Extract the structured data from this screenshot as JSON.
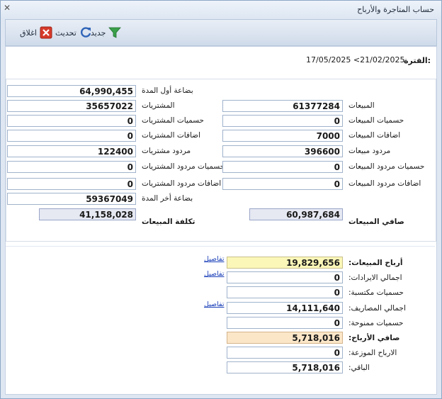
{
  "window": {
    "title": "حساب المتاجرة والأرباح"
  },
  "toolbar": {
    "new_label": "جديد",
    "refresh_label": "تحديث",
    "close_label": "اغلاق"
  },
  "period": {
    "label": "الفترة:",
    "value": "17/05/2025 <21/02/2025"
  },
  "left": {
    "opening_stock": {
      "label": "بضاعة أول المدة",
      "value": "64,990,455"
    },
    "purchases": {
      "label": "المشتريات",
      "value": "35657022"
    },
    "purchase_discounts": {
      "label": "حسميات المشتريات",
      "value": "0"
    },
    "purchase_additions": {
      "label": "اضافات المشتريات",
      "value": "0"
    },
    "purchase_returns": {
      "label": "مردود مشتريات",
      "value": "122400"
    },
    "purchase_return_discounts": {
      "label": "حسميات مردود المشتريات",
      "value": "0"
    },
    "purchase_return_additions": {
      "label": "اضافات مردود المشتريات",
      "value": "0"
    },
    "closing_stock": {
      "label": "بضاعة أخر المدة",
      "value": "59367049"
    },
    "cost_of_sales": {
      "label": "تكلفة المبيعات",
      "value": "41,158,028"
    }
  },
  "right": {
    "sales": {
      "label": "المبيعات",
      "value": "61377284"
    },
    "sales_discounts": {
      "label": "حسميات المبيعات",
      "value": "0"
    },
    "sales_additions": {
      "label": "اضافات المبيعات",
      "value": "7000"
    },
    "sales_returns": {
      "label": "مردود مبيعات",
      "value": "396600"
    },
    "sales_return_discounts": {
      "label": "حسميات مردود المبيعات",
      "value": "0"
    },
    "sales_return_additions": {
      "label": "اضافات مردود المبيعات",
      "value": "0"
    },
    "net_sales": {
      "label": "صافي المبيعات",
      "value": "60,987,684"
    }
  },
  "summary": {
    "details_link": "تفاصيل",
    "sales_profit": {
      "label": "أرباح المبيعات:",
      "value": "19,829,656"
    },
    "total_revenue": {
      "label": "اجمالي الايرادات:",
      "value": "0"
    },
    "earned_discounts": {
      "label": "حسميات مكتسبة:",
      "value": "0"
    },
    "total_expenses": {
      "label": "اجمالي المصاريف:",
      "value": "14,111,640"
    },
    "granted_discounts": {
      "label": "حسميات ممنوحة:",
      "value": "0"
    },
    "net_profit": {
      "label": "صافي الأرباح:",
      "value": "5,718,016"
    },
    "distributed_profit": {
      "label": "الارباح الموزعة:",
      "value": "0"
    },
    "remaining": {
      "label": "الباقي:",
      "value": "5,718,016"
    }
  }
}
